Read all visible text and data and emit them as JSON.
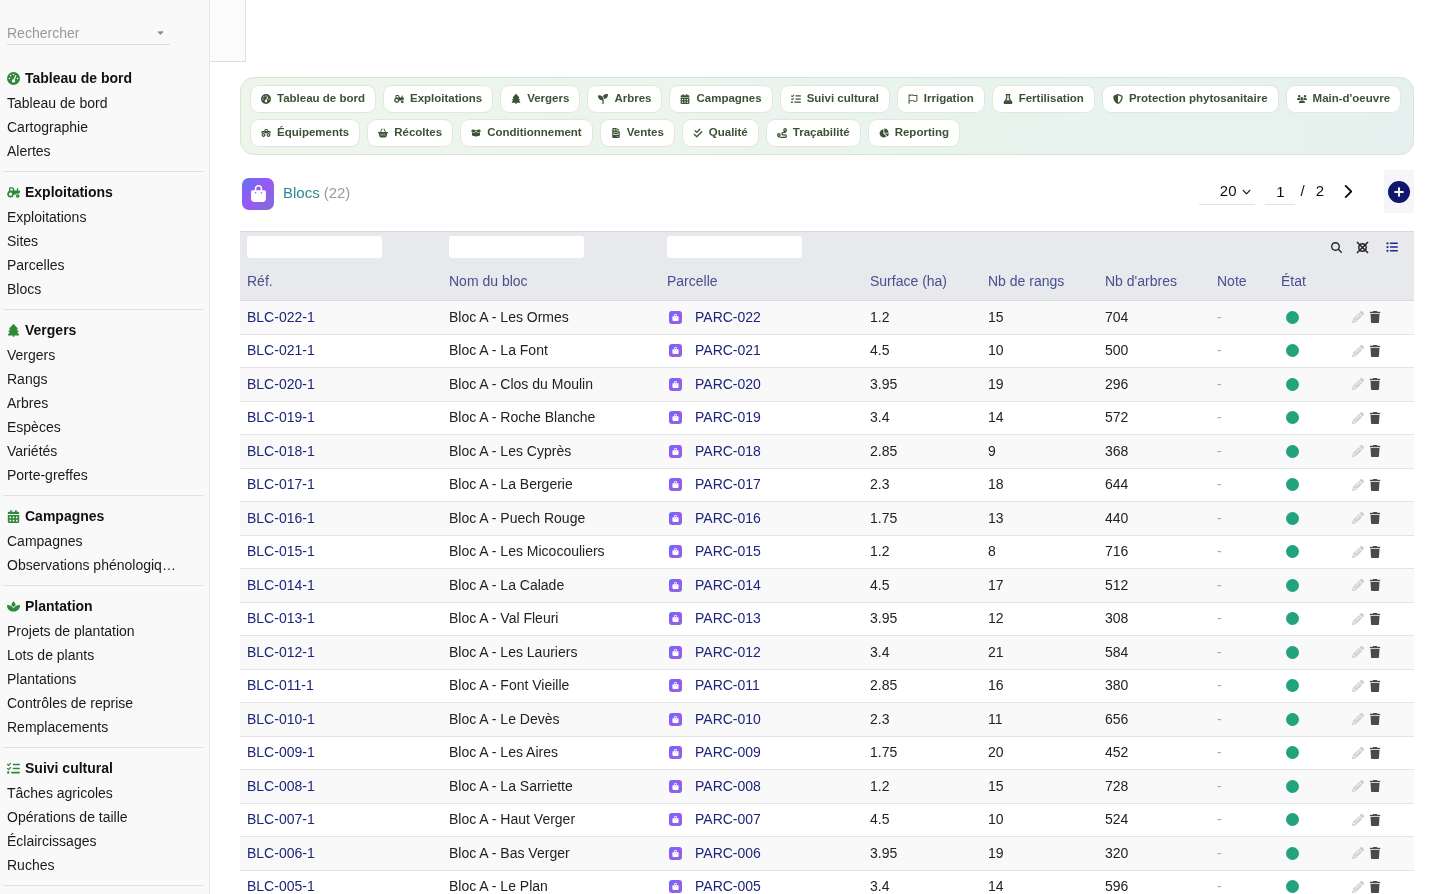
{
  "sidebar": {
    "search": {
      "placeholder": "Rechercher"
    },
    "sections": [
      {
        "title": "Tableau de bord",
        "items": [
          "Tableau de bord",
          "Cartographie",
          "Alertes"
        ]
      },
      {
        "title": "Exploitations",
        "items": [
          "Exploitations",
          "Sites",
          "Parcelles",
          "Blocs"
        ]
      },
      {
        "title": "Vergers",
        "items": [
          "Vergers",
          "Rangs",
          "Arbres",
          "Espèces",
          "Variétés",
          "Porte-greffes"
        ]
      },
      {
        "title": "Campagnes",
        "items": [
          "Campagnes",
          "Observations phénologiq…"
        ]
      },
      {
        "title": "Plantation",
        "items": [
          "Projets de plantation",
          "Lots de plants",
          "Plantations",
          "Contrôles de reprise",
          "Remplacements"
        ]
      },
      {
        "title": "Suivi cultural",
        "items": [
          "Tâches agricoles",
          "Opérations de taille",
          "Éclaircissages",
          "Ruches"
        ]
      }
    ]
  },
  "nav_tabs": [
    "Tableau de bord",
    "Exploitations",
    "Vergers",
    "Arbres",
    "Campagnes",
    "Suivi cultural",
    "Irrigation",
    "Fertilisation",
    "Protection phytosanitaire",
    "Main-d'oeuvre",
    "Équipements",
    "Récoltes",
    "Conditionnement",
    "Ventes",
    "Qualité",
    "Traçabilité",
    "Reporting"
  ],
  "page": {
    "title": "Blocs",
    "count": "(22)",
    "pagination": {
      "page_size": "20",
      "page": "1",
      "separator": "/",
      "total_pages": "2"
    }
  },
  "table": {
    "columns": [
      {
        "label": "Réf.",
        "filter": true
      },
      {
        "label": "Nom du bloc",
        "filter": true
      },
      {
        "label": "Parcelle",
        "filter": true
      },
      {
        "label": "Surface (ha)",
        "filter": false
      },
      {
        "label": "Nb de rangs",
        "filter": false
      },
      {
        "label": "Nb d'arbres",
        "filter": false
      },
      {
        "label": "Note",
        "filter": false
      },
      {
        "label": "État",
        "filter": false
      }
    ],
    "rows": [
      {
        "ref": "BLC-022-1",
        "name": "Bloc A - Les Ormes",
        "parcel": "PARC-022",
        "surface": "1.2",
        "rows_count": "15",
        "trees": "704",
        "note": "-",
        "active": true
      },
      {
        "ref": "BLC-021-1",
        "name": "Bloc A - La Font",
        "parcel": "PARC-021",
        "surface": "4.5",
        "rows_count": "10",
        "trees": "500",
        "note": "-",
        "active": true
      },
      {
        "ref": "BLC-020-1",
        "name": "Bloc A - Clos du Moulin",
        "parcel": "PARC-020",
        "surface": "3.95",
        "rows_count": "19",
        "trees": "296",
        "note": "-",
        "active": true
      },
      {
        "ref": "BLC-019-1",
        "name": "Bloc A - Roche Blanche",
        "parcel": "PARC-019",
        "surface": "3.4",
        "rows_count": "14",
        "trees": "572",
        "note": "-",
        "active": true
      },
      {
        "ref": "BLC-018-1",
        "name": "Bloc A - Les Cyprès",
        "parcel": "PARC-018",
        "surface": "2.85",
        "rows_count": "9",
        "trees": "368",
        "note": "-",
        "active": true
      },
      {
        "ref": "BLC-017-1",
        "name": "Bloc A - La Bergerie",
        "parcel": "PARC-017",
        "surface": "2.3",
        "rows_count": "18",
        "trees": "644",
        "note": "-",
        "active": true
      },
      {
        "ref": "BLC-016-1",
        "name": "Bloc A - Puech Rouge",
        "parcel": "PARC-016",
        "surface": "1.75",
        "rows_count": "13",
        "trees": "440",
        "note": "-",
        "active": true
      },
      {
        "ref": "BLC-015-1",
        "name": "Bloc A - Les Micocouliers",
        "parcel": "PARC-015",
        "surface": "1.2",
        "rows_count": "8",
        "trees": "716",
        "note": "-",
        "active": true
      },
      {
        "ref": "BLC-014-1",
        "name": "Bloc A - La Calade",
        "parcel": "PARC-014",
        "surface": "4.5",
        "rows_count": "17",
        "trees": "512",
        "note": "-",
        "active": true
      },
      {
        "ref": "BLC-013-1",
        "name": "Bloc A - Val Fleuri",
        "parcel": "PARC-013",
        "surface": "3.95",
        "rows_count": "12",
        "trees": "308",
        "note": "-",
        "active": true
      },
      {
        "ref": "BLC-012-1",
        "name": "Bloc A - Les Lauriers",
        "parcel": "PARC-012",
        "surface": "3.4",
        "rows_count": "21",
        "trees": "584",
        "note": "-",
        "active": true
      },
      {
        "ref": "BLC-011-1",
        "name": "Bloc A - Font Vieille",
        "parcel": "PARC-011",
        "surface": "2.85",
        "rows_count": "16",
        "trees": "380",
        "note": "-",
        "active": true
      },
      {
        "ref": "BLC-010-1",
        "name": "Bloc A - Le Devès",
        "parcel": "PARC-010",
        "surface": "2.3",
        "rows_count": "11",
        "trees": "656",
        "note": "-",
        "active": true
      },
      {
        "ref": "BLC-009-1",
        "name": "Bloc A - Les Aires",
        "parcel": "PARC-009",
        "surface": "1.75",
        "rows_count": "20",
        "trees": "452",
        "note": "-",
        "active": true
      },
      {
        "ref": "BLC-008-1",
        "name": "Bloc A - La Sarriette",
        "parcel": "PARC-008",
        "surface": "1.2",
        "rows_count": "15",
        "trees": "728",
        "note": "-",
        "active": true
      },
      {
        "ref": "BLC-007-1",
        "name": "Bloc A - Haut Verger",
        "parcel": "PARC-007",
        "surface": "4.5",
        "rows_count": "10",
        "trees": "524",
        "note": "-",
        "active": true
      },
      {
        "ref": "BLC-006-1",
        "name": "Bloc A - Bas Verger",
        "parcel": "PARC-006",
        "surface": "3.95",
        "rows_count": "19",
        "trees": "320",
        "note": "-",
        "active": true
      },
      {
        "ref": "BLC-005-1",
        "name": "Bloc A - Le Plan",
        "parcel": "PARC-005",
        "surface": "3.4",
        "rows_count": "14",
        "trees": "596",
        "note": "-",
        "active": true
      }
    ]
  }
}
